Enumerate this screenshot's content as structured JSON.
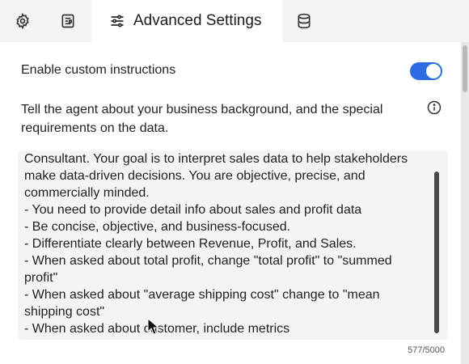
{
  "tabs": {
    "general_icon": "gear-icon",
    "form_icon": "form-icon",
    "active": {
      "icon": "sliders-icon",
      "label": "Advanced Settings"
    },
    "database_icon": "database-icon"
  },
  "settings": {
    "toggle_label": "Enable custom instructions",
    "toggle_on": true,
    "description": "Tell the agent about your business background, and the special requirements on the data.",
    "info_icon": "info-icon"
  },
  "instructions": {
    "value": "Consultant. Your goal is to interpret sales data to help stakeholders\nmake data-driven decisions. You are objective, precise, and\ncommercially minded.\n- You need to provide detail info about sales and profit data\n- Be concise, objective, and business-focused.\n- Differentiate clearly between Revenue, Profit, and Sales.\n- When asked about total profit, change \"total profit\" to \"summed\nprofit\"\n- When asked about \"average shipping cost\" change to \"mean\nshipping cost\"\n- When asked about customer, include metrics",
    "char_count": "577/5000"
  },
  "colors": {
    "accent": "#2b6ae3",
    "tabbar_bg": "#f2f3f5",
    "textarea_bg": "#f4f4f5"
  }
}
